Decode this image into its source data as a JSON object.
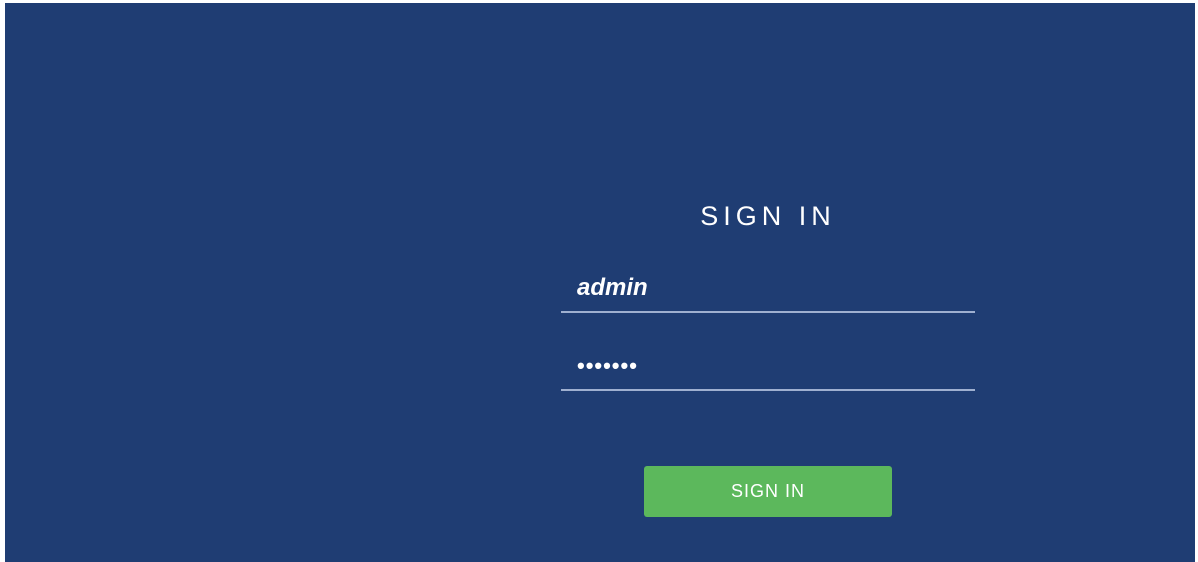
{
  "colors": {
    "background": "#1f3d73",
    "button": "#5cb85c",
    "underline": "#9fb0d0",
    "text": "#ffffff"
  },
  "login": {
    "title": "SIGN IN",
    "username_value": "admin",
    "password_value": "1234567",
    "button_label": "SIGN IN"
  }
}
